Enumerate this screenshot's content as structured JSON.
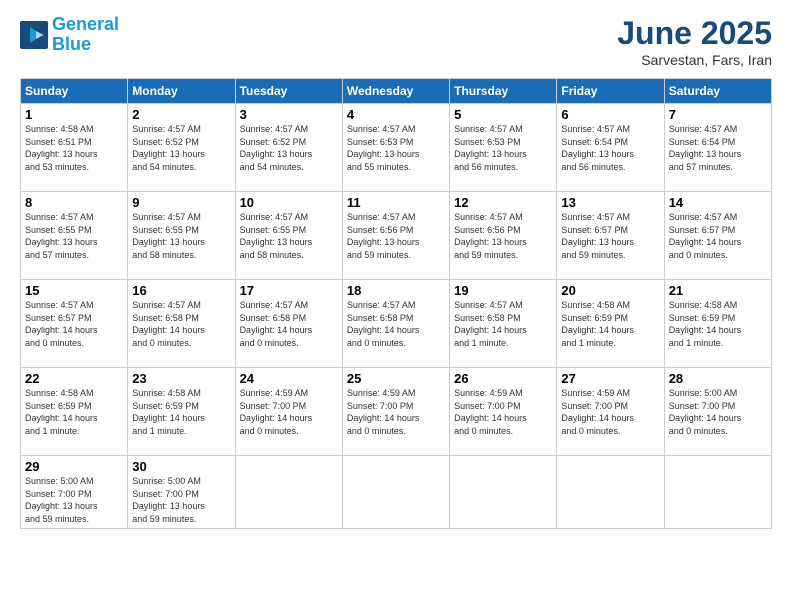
{
  "header": {
    "logo_line1": "General",
    "logo_line2": "Blue",
    "month": "June 2025",
    "location": "Sarvestan, Fars, Iran"
  },
  "weekdays": [
    "Sunday",
    "Monday",
    "Tuesday",
    "Wednesday",
    "Thursday",
    "Friday",
    "Saturday"
  ],
  "weeks": [
    [
      {
        "day": "1",
        "info": "Sunrise: 4:58 AM\nSunset: 6:51 PM\nDaylight: 13 hours\nand 53 minutes."
      },
      {
        "day": "2",
        "info": "Sunrise: 4:57 AM\nSunset: 6:52 PM\nDaylight: 13 hours\nand 54 minutes."
      },
      {
        "day": "3",
        "info": "Sunrise: 4:57 AM\nSunset: 6:52 PM\nDaylight: 13 hours\nand 54 minutes."
      },
      {
        "day": "4",
        "info": "Sunrise: 4:57 AM\nSunset: 6:53 PM\nDaylight: 13 hours\nand 55 minutes."
      },
      {
        "day": "5",
        "info": "Sunrise: 4:57 AM\nSunset: 6:53 PM\nDaylight: 13 hours\nand 56 minutes."
      },
      {
        "day": "6",
        "info": "Sunrise: 4:57 AM\nSunset: 6:54 PM\nDaylight: 13 hours\nand 56 minutes."
      },
      {
        "day": "7",
        "info": "Sunrise: 4:57 AM\nSunset: 6:54 PM\nDaylight: 13 hours\nand 57 minutes."
      }
    ],
    [
      {
        "day": "8",
        "info": "Sunrise: 4:57 AM\nSunset: 6:55 PM\nDaylight: 13 hours\nand 57 minutes."
      },
      {
        "day": "9",
        "info": "Sunrise: 4:57 AM\nSunset: 6:55 PM\nDaylight: 13 hours\nand 58 minutes."
      },
      {
        "day": "10",
        "info": "Sunrise: 4:57 AM\nSunset: 6:55 PM\nDaylight: 13 hours\nand 58 minutes."
      },
      {
        "day": "11",
        "info": "Sunrise: 4:57 AM\nSunset: 6:56 PM\nDaylight: 13 hours\nand 59 minutes."
      },
      {
        "day": "12",
        "info": "Sunrise: 4:57 AM\nSunset: 6:56 PM\nDaylight: 13 hours\nand 59 minutes."
      },
      {
        "day": "13",
        "info": "Sunrise: 4:57 AM\nSunset: 6:57 PM\nDaylight: 13 hours\nand 59 minutes."
      },
      {
        "day": "14",
        "info": "Sunrise: 4:57 AM\nSunset: 6:57 PM\nDaylight: 14 hours\nand 0 minutes."
      }
    ],
    [
      {
        "day": "15",
        "info": "Sunrise: 4:57 AM\nSunset: 6:57 PM\nDaylight: 14 hours\nand 0 minutes."
      },
      {
        "day": "16",
        "info": "Sunrise: 4:57 AM\nSunset: 6:58 PM\nDaylight: 14 hours\nand 0 minutes."
      },
      {
        "day": "17",
        "info": "Sunrise: 4:57 AM\nSunset: 6:58 PM\nDaylight: 14 hours\nand 0 minutes."
      },
      {
        "day": "18",
        "info": "Sunrise: 4:57 AM\nSunset: 6:58 PM\nDaylight: 14 hours\nand 0 minutes."
      },
      {
        "day": "19",
        "info": "Sunrise: 4:57 AM\nSunset: 6:58 PM\nDaylight: 14 hours\nand 1 minute."
      },
      {
        "day": "20",
        "info": "Sunrise: 4:58 AM\nSunset: 6:59 PM\nDaylight: 14 hours\nand 1 minute."
      },
      {
        "day": "21",
        "info": "Sunrise: 4:58 AM\nSunset: 6:59 PM\nDaylight: 14 hours\nand 1 minute."
      }
    ],
    [
      {
        "day": "22",
        "info": "Sunrise: 4:58 AM\nSunset: 6:59 PM\nDaylight: 14 hours\nand 1 minute."
      },
      {
        "day": "23",
        "info": "Sunrise: 4:58 AM\nSunset: 6:59 PM\nDaylight: 14 hours\nand 1 minute."
      },
      {
        "day": "24",
        "info": "Sunrise: 4:59 AM\nSunset: 7:00 PM\nDaylight: 14 hours\nand 0 minutes."
      },
      {
        "day": "25",
        "info": "Sunrise: 4:59 AM\nSunset: 7:00 PM\nDaylight: 14 hours\nand 0 minutes."
      },
      {
        "day": "26",
        "info": "Sunrise: 4:59 AM\nSunset: 7:00 PM\nDaylight: 14 hours\nand 0 minutes."
      },
      {
        "day": "27",
        "info": "Sunrise: 4:59 AM\nSunset: 7:00 PM\nDaylight: 14 hours\nand 0 minutes."
      },
      {
        "day": "28",
        "info": "Sunrise: 5:00 AM\nSunset: 7:00 PM\nDaylight: 14 hours\nand 0 minutes."
      }
    ],
    [
      {
        "day": "29",
        "info": "Sunrise: 5:00 AM\nSunset: 7:00 PM\nDaylight: 13 hours\nand 59 minutes."
      },
      {
        "day": "30",
        "info": "Sunrise: 5:00 AM\nSunset: 7:00 PM\nDaylight: 13 hours\nand 59 minutes."
      },
      null,
      null,
      null,
      null,
      null
    ]
  ]
}
